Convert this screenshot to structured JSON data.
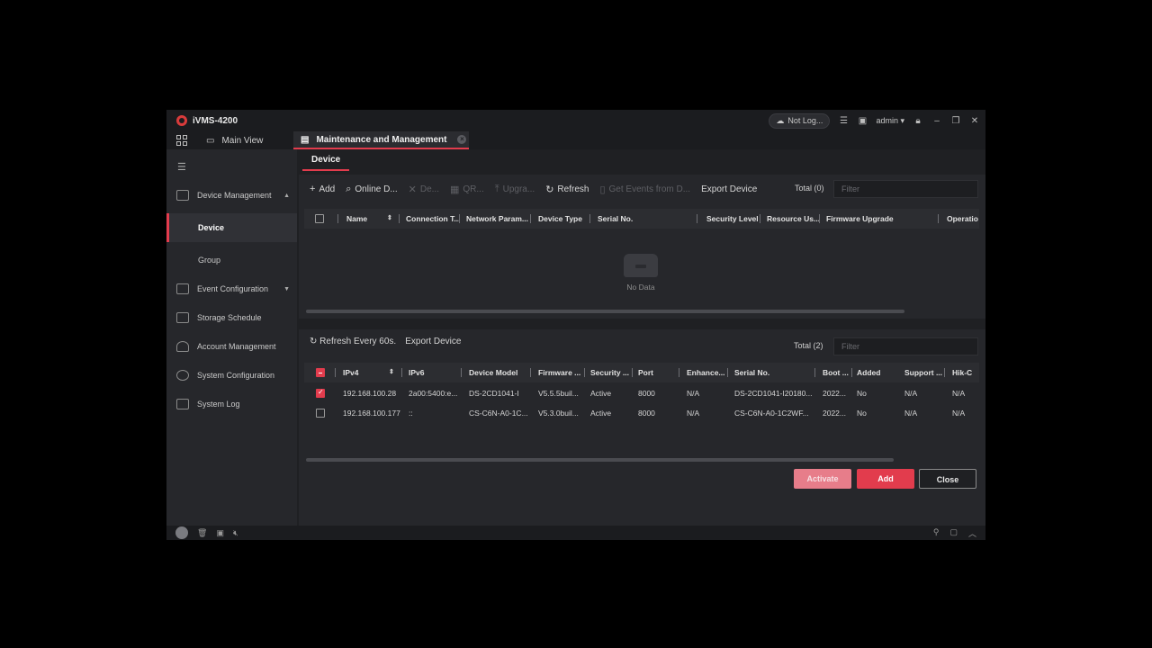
{
  "app": {
    "title": "iVMS-4200",
    "login_status": "Not Log...",
    "user": "admin",
    "brand_color": "#e23c4d"
  },
  "tabs": {
    "main_view": "Main View",
    "maintenance": "Maintenance and Management"
  },
  "sidebar": {
    "items": [
      {
        "label": "Device Management",
        "icon": "device-management-icon"
      },
      {
        "label": "Device"
      },
      {
        "label": "Group"
      },
      {
        "label": "Event Configuration",
        "icon": "event-icon"
      },
      {
        "label": "Storage Schedule",
        "icon": "storage-icon"
      },
      {
        "label": "Account Management",
        "icon": "account-icon"
      },
      {
        "label": "System Configuration",
        "icon": "gear-icon"
      },
      {
        "label": "System Log",
        "icon": "log-icon"
      }
    ]
  },
  "subtab": "Device",
  "toolbar": {
    "add": "Add",
    "online": "Online D...",
    "delete": "De...",
    "qr": "QR...",
    "upgrade": "Upgra...",
    "refresh": "Refresh",
    "get_events": "Get Events from D...",
    "export": "Export Device",
    "total": "Total (0)",
    "filter_placeholder": "Filter"
  },
  "device_table": {
    "headers": [
      "Name",
      "Connection T...",
      "Network Param...",
      "Device Type",
      "Serial No.",
      "Security Level",
      "Resource Us...",
      "Firmware Upgrade",
      "Operatio"
    ],
    "empty_text": "No Data"
  },
  "online_panel": {
    "refresh": "Refresh Every 60s.",
    "export": "Export Device",
    "total": "Total (2)",
    "filter_placeholder": "Filter",
    "headers": [
      "IPv4",
      "IPv6",
      "Device Model",
      "Firmware ...",
      "Security ...",
      "Port",
      "Enhance...",
      "Serial No.",
      "Boot ...",
      "Added",
      "Support ...",
      "Hik-C"
    ],
    "rows": [
      {
        "checked": true,
        "ipv4": "192.168.100.28",
        "ipv6": "2a00:5400:e...",
        "model": "DS-2CD1041-I",
        "firmware": "V5.5.5buil...",
        "security": "Active",
        "port": "8000",
        "enhance": "N/A",
        "serial": "DS-2CD1041-I20180...",
        "boot": "2022...",
        "added": "No",
        "support": "N/A",
        "hik": "N/A"
      },
      {
        "checked": false,
        "ipv4": "192.168.100.177",
        "ipv6": "::",
        "model": "CS-C6N-A0-1C...",
        "firmware": "V5.3.0buil...",
        "security": "Active",
        "port": "8000",
        "enhance": "N/A",
        "serial": "CS-C6N-A0-1C2WF...",
        "boot": "2022...",
        "added": "No",
        "support": "N/A",
        "hik": "N/A"
      }
    ]
  },
  "buttons": {
    "activate": "Activate",
    "add": "Add",
    "close": "Close"
  }
}
